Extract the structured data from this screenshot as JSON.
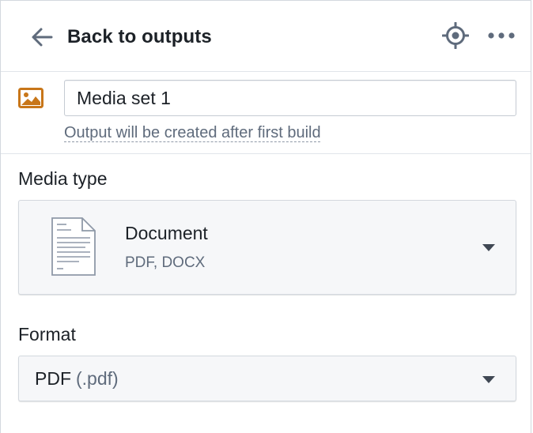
{
  "header": {
    "back_label": "Back to outputs",
    "back_icon": "arrow-left-icon",
    "locate_icon": "locate-icon",
    "more_icon": "more-horizontal-icon"
  },
  "output": {
    "icon": "media-image-icon",
    "icon_color": "#C87619",
    "name_value": "Media set 1",
    "note": "Output will be created after first build"
  },
  "media_type": {
    "label": "Media type",
    "selected_title": "Document",
    "selected_subtitle": "PDF, DOCX",
    "icon": "document-icon"
  },
  "format": {
    "label": "Format",
    "selected_value": "PDF",
    "selected_extension": "(.pdf)"
  },
  "colors": {
    "text_primary": "#1C2127",
    "text_muted": "#5F6B7C",
    "select_bg": "#F6F7F9",
    "border": "#D3D8DE"
  }
}
